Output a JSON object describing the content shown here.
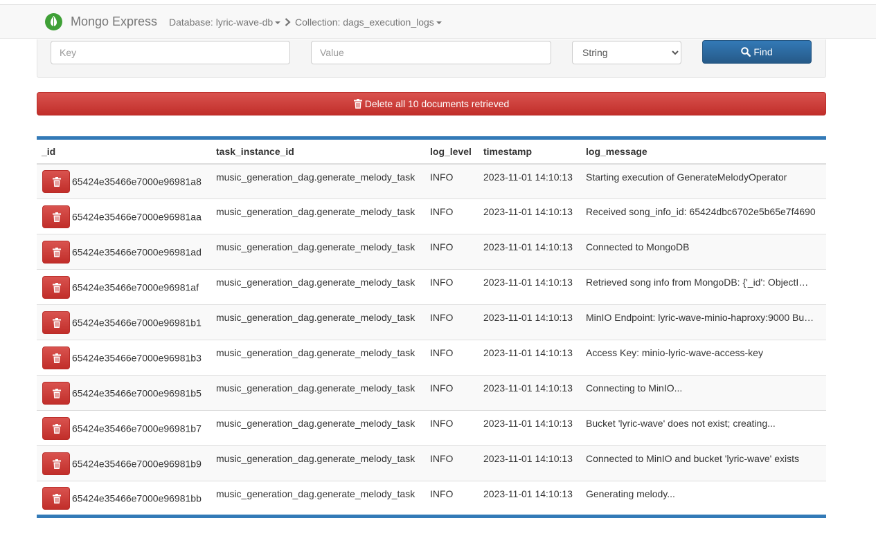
{
  "app": {
    "brand": "Mongo Express",
    "database_crumb": "Database: lyric-wave-db",
    "collection_crumb": "Collection: dags_execution_logs"
  },
  "search": {
    "key_placeholder": "Key",
    "value_placeholder": "Value",
    "type_selected": "String",
    "find_label": "Find"
  },
  "delete_all_label": "Delete all 10 documents retrieved",
  "table": {
    "columns": [
      "_id",
      "task_instance_id",
      "log_level",
      "timestamp",
      "log_message"
    ],
    "rows": [
      {
        "id": "65424e35466e7000e96981a8",
        "task": "music_generation_dag.generate_melody_task",
        "level": "INFO",
        "ts": "2023-11-01 14:10:13",
        "msg": "Starting execution of GenerateMelodyOperator"
      },
      {
        "id": "65424e35466e7000e96981aa",
        "task": "music_generation_dag.generate_melody_task",
        "level": "INFO",
        "ts": "2023-11-01 14:10:13",
        "msg": "Received song_info_id: 65424dbc6702e5b65e7f4690"
      },
      {
        "id": "65424e35466e7000e96981ad",
        "task": "music_generation_dag.generate_melody_task",
        "level": "INFO",
        "ts": "2023-11-01 14:10:13",
        "msg": "Connected to MongoDB"
      },
      {
        "id": "65424e35466e7000e96981af",
        "task": "music_generation_dag.generate_melody_task",
        "level": "INFO",
        "ts": "2023-11-01 14:10:13",
        "msg": "Retrieved song info from MongoDB: {'_id': ObjectI…"
      },
      {
        "id": "65424e35466e7000e96981b1",
        "task": "music_generation_dag.generate_melody_task",
        "level": "INFO",
        "ts": "2023-11-01 14:10:13",
        "msg": "MinIO Endpoint: lyric-wave-minio-haproxy:9000 Bu…"
      },
      {
        "id": "65424e35466e7000e96981b3",
        "task": "music_generation_dag.generate_melody_task",
        "level": "INFO",
        "ts": "2023-11-01 14:10:13",
        "msg": "Access Key: minio-lyric-wave-access-key"
      },
      {
        "id": "65424e35466e7000e96981b5",
        "task": "music_generation_dag.generate_melody_task",
        "level": "INFO",
        "ts": "2023-11-01 14:10:13",
        "msg": "Connecting to MinIO..."
      },
      {
        "id": "65424e35466e7000e96981b7",
        "task": "music_generation_dag.generate_melody_task",
        "level": "INFO",
        "ts": "2023-11-01 14:10:13",
        "msg": "Bucket 'lyric-wave' does not exist; creating..."
      },
      {
        "id": "65424e35466e7000e96981b9",
        "task": "music_generation_dag.generate_melody_task",
        "level": "INFO",
        "ts": "2023-11-01 14:10:13",
        "msg": "Connected to MinIO and bucket 'lyric-wave' exists"
      },
      {
        "id": "65424e35466e7000e96981bb",
        "task": "music_generation_dag.generate_melody_task",
        "level": "INFO",
        "ts": "2023-11-01 14:10:13",
        "msg": "Generating melody..."
      }
    ]
  },
  "colors": {
    "primary": "#337ab7",
    "danger": "#d9534f",
    "brand_green": "#3fa037"
  },
  "icons": {
    "brand": "mongodb-leaf-icon",
    "trash": "trash-icon",
    "search": "search-icon",
    "breadcrumb_separator": "chevron-right-icon",
    "dropdown": "caret-down-icon"
  }
}
